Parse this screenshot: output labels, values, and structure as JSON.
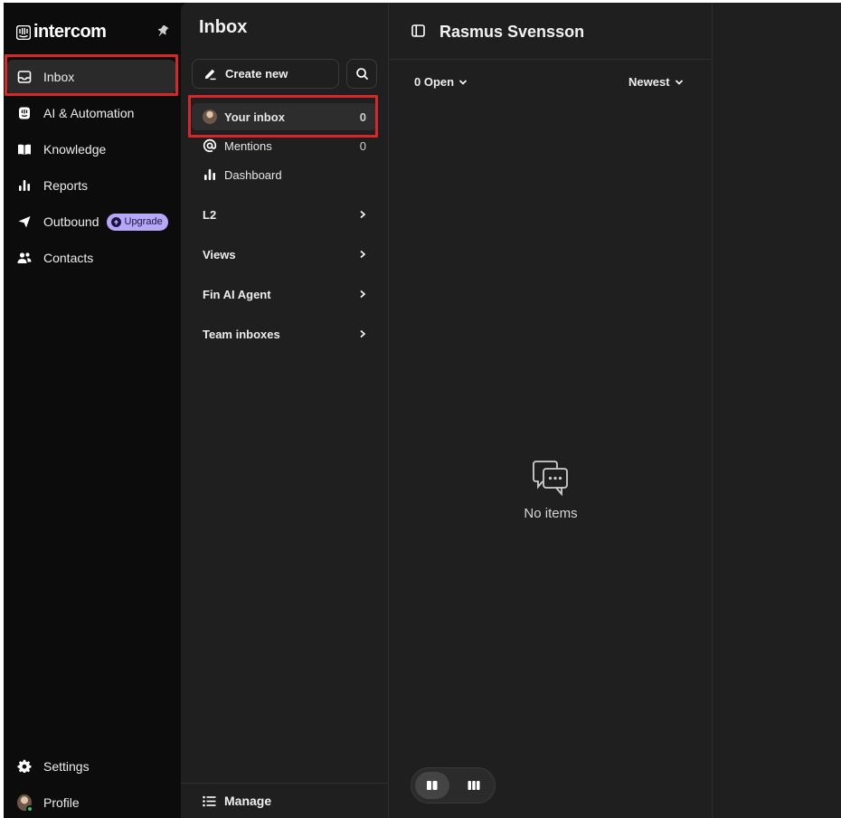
{
  "brand": {
    "name": "intercom"
  },
  "nav": {
    "items": [
      {
        "label": "Inbox",
        "icon": "inbox-icon",
        "active": true
      },
      {
        "label": "AI & Automation",
        "icon": "ai-automation-icon"
      },
      {
        "label": "Knowledge",
        "icon": "book-icon"
      },
      {
        "label": "Reports",
        "icon": "bar-chart-icon"
      },
      {
        "label": "Outbound",
        "icon": "paper-plane-icon",
        "badge": "Upgrade"
      },
      {
        "label": "Contacts",
        "icon": "people-icon"
      }
    ],
    "bottom": [
      {
        "label": "Settings",
        "icon": "gear-icon"
      },
      {
        "label": "Profile",
        "icon": "avatar"
      }
    ]
  },
  "inbox_panel": {
    "title": "Inbox",
    "create_label": "Create new",
    "items": [
      {
        "label": "Your inbox",
        "count": "0",
        "active": true
      },
      {
        "label": "Mentions",
        "count": "0"
      },
      {
        "label": "Dashboard",
        "count": ""
      }
    ],
    "sections": [
      "L2",
      "Views",
      "Fin AI Agent",
      "Team inboxes"
    ],
    "manage_label": "Manage"
  },
  "conversation_list": {
    "title": "Rasmus Svensson",
    "status_filter": "0 Open",
    "sort": "Newest",
    "empty_label": "No items"
  },
  "colors": {
    "background": "#0c0c0c",
    "panel": "#1f1f1f",
    "highlight": "#d62828",
    "upgrade_badge": "#b7a7f7"
  }
}
